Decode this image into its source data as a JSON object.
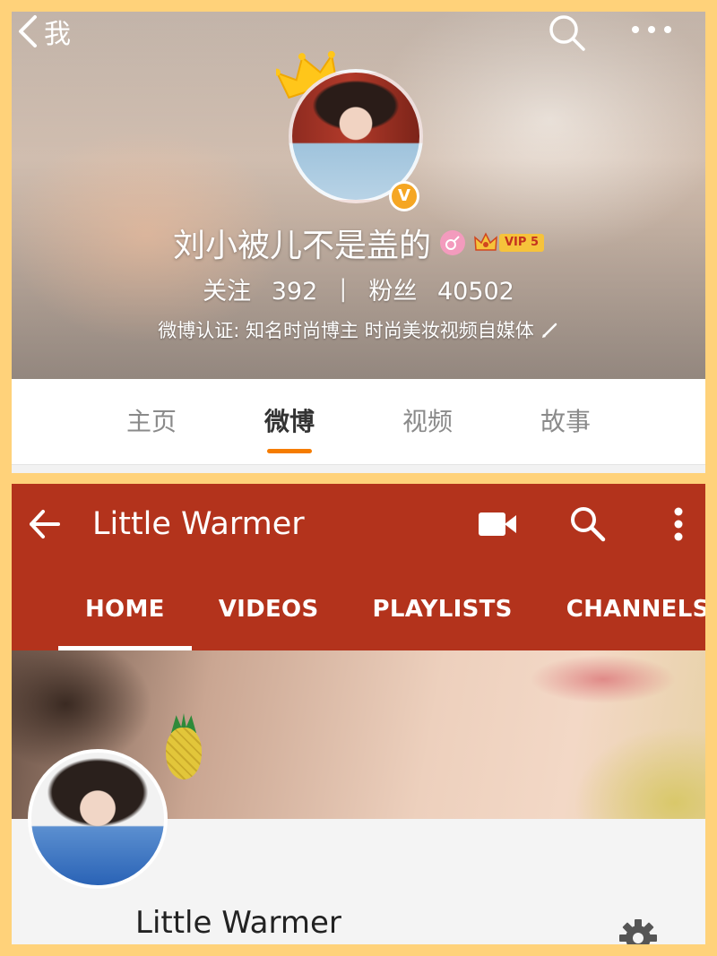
{
  "weibo": {
    "back_label": "我",
    "username": "刘小被儿不是盖的",
    "vip_label": "VIP 5",
    "following_label": "关注",
    "following_count": "392",
    "stats_separator": "|",
    "followers_label": "粉丝",
    "followers_count": "40502",
    "verification": "微博认证: 知名时尚博主 时尚美妆视频自媒体",
    "verified_badge": "V",
    "tabs": [
      "主页",
      "微博",
      "视频",
      "故事"
    ],
    "active_tab": "微博",
    "colors": {
      "accent": "#f57c00",
      "vip": "#f6c33b"
    }
  },
  "youtube": {
    "channel_title": "Little Warmer",
    "tabs": [
      "HOME",
      "VIDEOS",
      "PLAYLISTS",
      "CHANNELS"
    ],
    "active_tab": "HOME",
    "channel_name": "Little Warmer",
    "icons": [
      "arrow-back-icon",
      "video-camera-icon",
      "search-icon",
      "more-vert-icon",
      "gear-icon"
    ],
    "colors": {
      "app_bar": "#b3331c"
    }
  },
  "frame_color": "#ffd27a"
}
